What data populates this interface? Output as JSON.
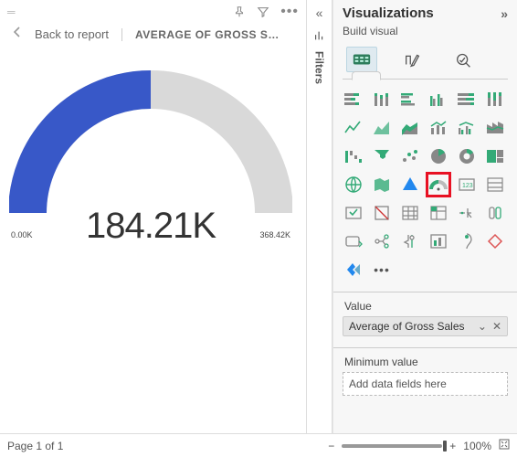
{
  "header": {
    "back_label": "Back to report",
    "tile_title": "AVERAGE OF GROSS SAL…"
  },
  "filters_label": "Filters",
  "viz_panel": {
    "title": "Visualizations",
    "subtitle": "Build visual",
    "value_label": "Value",
    "value_field": "Average of Gross Sales",
    "min_label": "Minimum value",
    "min_placeholder": "Add data fields here"
  },
  "chart_data": {
    "type": "gauge",
    "value": 184.21,
    "min": 0.0,
    "max": 368.42,
    "unit_suffix": "K",
    "value_display": "184.21K",
    "min_display": "0.00K",
    "max_display": "368.42K",
    "fill_color": "#3858c8",
    "track_color": "#d9d9d9"
  },
  "footer": {
    "page_status": "Page 1 of 1",
    "zoom_label": "100%"
  }
}
